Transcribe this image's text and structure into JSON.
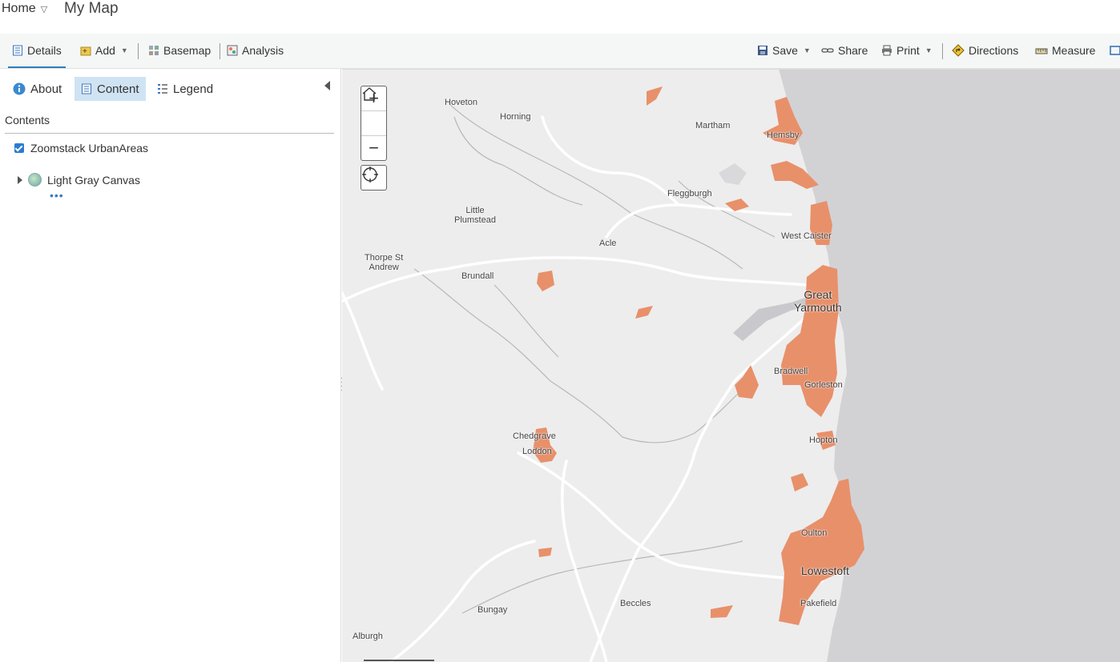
{
  "header": {
    "home_label": "Home",
    "map_title": "My Map"
  },
  "toolbar": {
    "details": "Details",
    "add": "Add",
    "basemap": "Basemap",
    "analysis": "Analysis",
    "save": "Save",
    "share": "Share",
    "print": "Print",
    "directions": "Directions",
    "measure": "Measure"
  },
  "panel": {
    "tabs": {
      "about": "About",
      "content": "Content",
      "legend": "Legend"
    },
    "contents_heading": "Contents",
    "layers": [
      {
        "name": "Zoomstack UrbanAreas",
        "checked": true
      },
      {
        "name": "Light Gray Canvas"
      }
    ],
    "more": "•••"
  },
  "map": {
    "zoom_in": "+",
    "zoom_out": "−",
    "places": {
      "hoveton": "Hoveton",
      "horning": "Horning",
      "martham": "Martham",
      "hemsby": "Hemsby",
      "fleggburgh": "Fleggburgh",
      "little": "Little",
      "plumstead": "Plumstead",
      "acle": "Acle",
      "west_caister": "West Caister",
      "thorpe1": "Thorpe St",
      "thorpe2": "Andrew",
      "brundall": "Brundall",
      "great": "Great",
      "yarmouth": "Yarmouth",
      "bradwell": "Bradwell",
      "gorleston": "Gorleston",
      "chedgrave": "Chedgrave",
      "loddon": "Loddon",
      "hopton": "Hopton",
      "oulton": "Oulton",
      "lowestoft": "Lowestoft",
      "pakefield": "Pakefield",
      "beccles": "Beccles",
      "bungay": "Bungay",
      "alburgh": "Alburgh"
    },
    "colors": {
      "land": "#ededed",
      "sea": "#d2d2d5",
      "urban": "#e8906a",
      "road": "#ffffff",
      "water": "#c8c8cc"
    }
  }
}
